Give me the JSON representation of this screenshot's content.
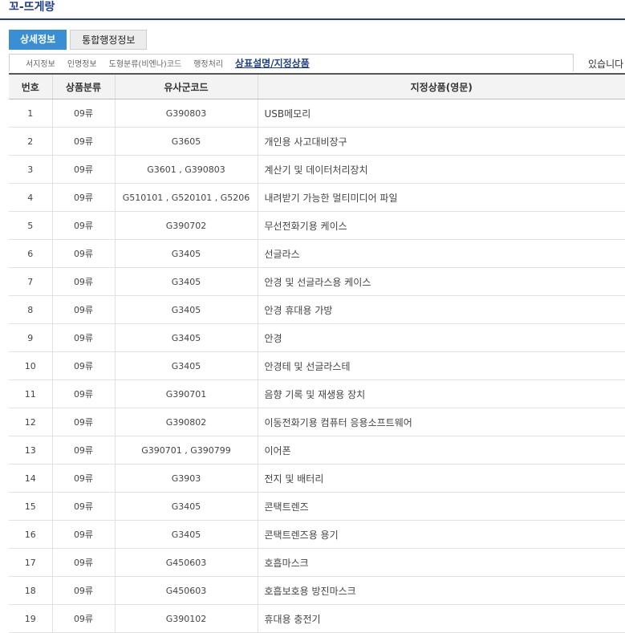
{
  "page_title": "꼬-뜨게랑",
  "tabs": [
    {
      "label": "상세정보",
      "active": true
    },
    {
      "label": "통합행정정보",
      "active": false
    }
  ],
  "subtabs": [
    {
      "label": "서지정보",
      "active": false
    },
    {
      "label": "인명정보",
      "active": false
    },
    {
      "label": "도형분류(비엔나)코드",
      "active": false
    },
    {
      "label": "행정처리",
      "active": false
    },
    {
      "label": "상표설명/지정상품",
      "active": true
    }
  ],
  "overflow_text": "있습니다",
  "table": {
    "headers": [
      "번호",
      "상품분류",
      "유사군코드",
      "지정상품(영문)"
    ],
    "rows": [
      [
        "1",
        "09류",
        "G390803",
        "USB메모리"
      ],
      [
        "2",
        "09류",
        "G3605",
        "개인용 사고대비장구"
      ],
      [
        "3",
        "09류",
        "G3601 , G390803",
        "계산기 및 데이터처리장치"
      ],
      [
        "4",
        "09류",
        "G510101 , G520101 , G5206",
        "내려받기 가능한 멀티미디어 파일"
      ],
      [
        "5",
        "09류",
        "G390702",
        "무선전화기용 케이스"
      ],
      [
        "6",
        "09류",
        "G3405",
        "선글라스"
      ],
      [
        "7",
        "09류",
        "G3405",
        "안경 및 선글라스용 케이스"
      ],
      [
        "8",
        "09류",
        "G3405",
        "안경 휴대용 가방"
      ],
      [
        "9",
        "09류",
        "G3405",
        "안경"
      ],
      [
        "10",
        "09류",
        "G3405",
        "안경테 및 선글라스테"
      ],
      [
        "11",
        "09류",
        "G390701",
        "음향 기록 및 재생용 장치"
      ],
      [
        "12",
        "09류",
        "G390802",
        "이동전화기용 컴퓨터 응용소프트웨어"
      ],
      [
        "13",
        "09류",
        "G390701 , G390799",
        "이어폰"
      ],
      [
        "14",
        "09류",
        "G3903",
        "전지 및 배터리"
      ],
      [
        "15",
        "09류",
        "G3405",
        "콘택트렌즈"
      ],
      [
        "16",
        "09류",
        "G3405",
        "콘택트렌즈용 용기"
      ],
      [
        "17",
        "09류",
        "G450603",
        "호흡마스크"
      ],
      [
        "18",
        "09류",
        "G450603",
        "호흡보호용 방진마스크"
      ],
      [
        "19",
        "09류",
        "G390102",
        "휴대용 충전기"
      ]
    ]
  }
}
